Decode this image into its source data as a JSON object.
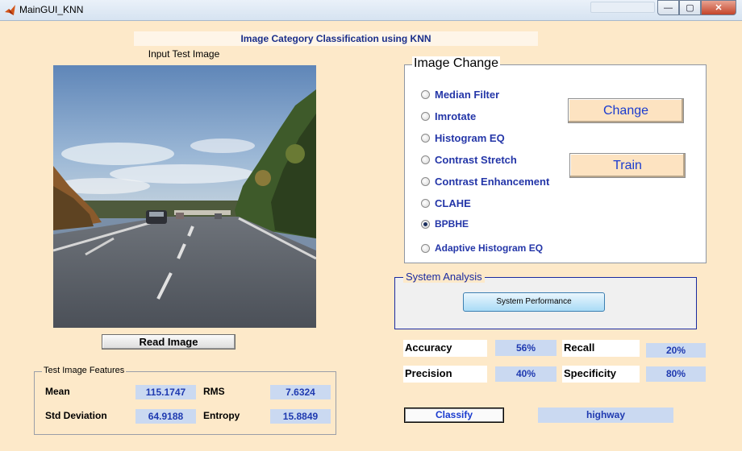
{
  "window": {
    "title": "MainGUI_KNN",
    "min_glyph": "—",
    "max_glyph": "▢",
    "close_glyph": "✕"
  },
  "header": {
    "title": "Image Category Classification using KNN"
  },
  "input_image": {
    "label": "Input Test Image",
    "read_button": "Read Image"
  },
  "features": {
    "title": "Test Image Features",
    "mean_label": "Mean",
    "mean_value": "115.1747",
    "rms_label": "RMS",
    "rms_value": "7.6324",
    "std_label": "Std Deviation",
    "std_value": "64.9188",
    "entropy_label": "Entropy",
    "entropy_value": "15.8849"
  },
  "image_change": {
    "title": "Image Change",
    "options": [
      "Median Filter",
      "Imrotate",
      "Histogram EQ",
      "Contrast Stretch",
      "Contrast Enhancement",
      "CLAHE",
      "BPBHE",
      "Adaptive Histogram EQ"
    ],
    "selected": "BPBHE",
    "change_button": "Change",
    "train_button": "Train"
  },
  "system_analysis": {
    "title": "System Analysis",
    "performance_button": "System Performance"
  },
  "metrics": {
    "accuracy_label": "Accuracy",
    "accuracy_value": "56%",
    "recall_label": "Recall",
    "recall_value": "20%",
    "precision_label": "Precision",
    "precision_value": "40%",
    "specificity_label": "Specificity",
    "specificity_value": "80%"
  },
  "classify": {
    "button": "Classify",
    "result": "highway"
  },
  "colors": {
    "background": "#fde9c9",
    "accent_blue": "#2436a8",
    "value_box": "#cad9f1"
  },
  "icons": {
    "app": "matlab-icon"
  }
}
